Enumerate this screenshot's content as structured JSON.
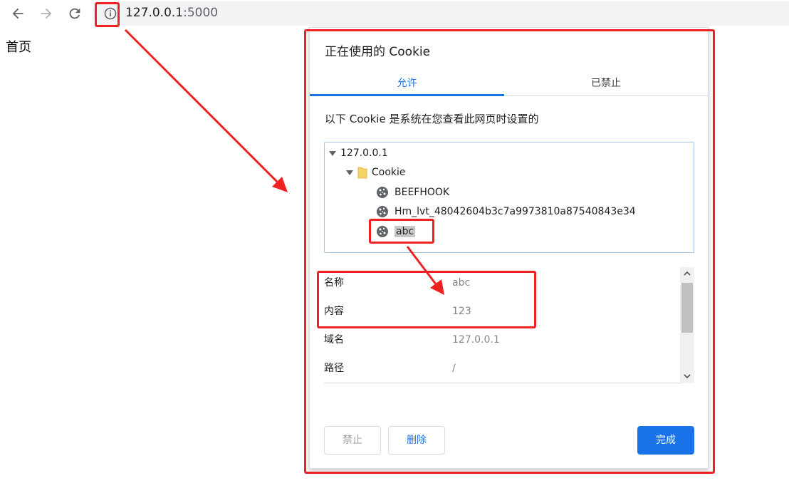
{
  "browser": {
    "url_host": "127.0.0.1",
    "url_port": ":5000"
  },
  "page": {
    "heading": "首页"
  },
  "dialog": {
    "title": "正在使用的 Cookie",
    "tabs": [
      "允许",
      "已禁止"
    ],
    "active_tab": "允许",
    "subtitle": "以下 Cookie 是系统在您查看此网页时设置的",
    "tree": {
      "host": "127.0.0.1",
      "folder": "Cookie",
      "cookies": [
        "BEEFHOOK",
        "Hm_lvt_48042604b3c7a9973810a87540843e34",
        "abc"
      ],
      "selected": "abc"
    },
    "details": [
      {
        "label": "名称",
        "value": "abc"
      },
      {
        "label": "内容",
        "value": "123"
      },
      {
        "label": "域名",
        "value": "127.0.0.1"
      },
      {
        "label": "路径",
        "value": "/"
      }
    ],
    "buttons": {
      "block": "禁止",
      "remove": "删除",
      "done": "完成"
    }
  },
  "colors": {
    "accent": "#1a73e8",
    "annotation": "#ee2222"
  }
}
